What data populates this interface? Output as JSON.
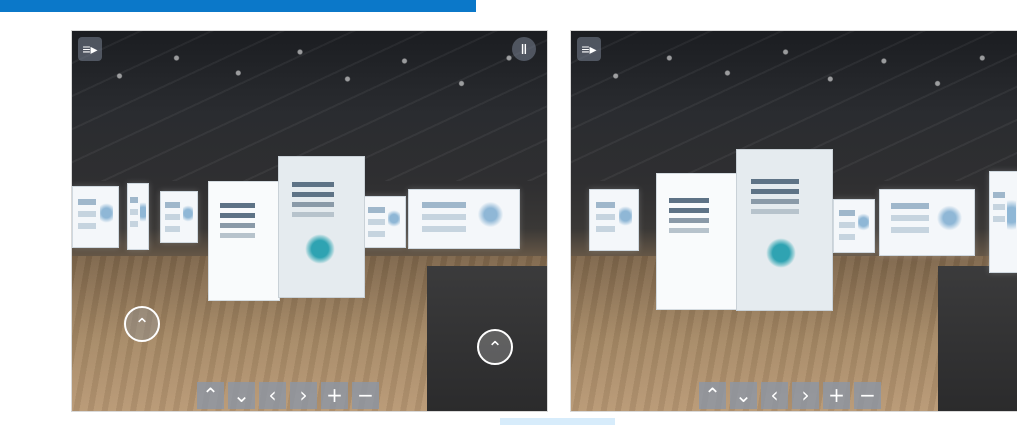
{
  "header_bar_color": "#0b78c9",
  "viewers": [
    {
      "menu_icon": "menu-expand-icon",
      "pause_icon": "pause-icon",
      "nav_icon": "chevron-up-circle-icon",
      "controls": [
        {
          "icon": "up-icon",
          "glyph": "⌃"
        },
        {
          "icon": "down-icon",
          "glyph": "⌄"
        },
        {
          "icon": "left-icon",
          "glyph": "‹"
        },
        {
          "icon": "right-icon",
          "glyph": "›"
        },
        {
          "icon": "zoom-in-icon",
          "glyph": "+"
        },
        {
          "icon": "zoom-out-icon",
          "glyph": "−"
        }
      ]
    },
    {
      "menu_icon": "menu-expand-icon",
      "controls": [
        {
          "icon": "up-icon",
          "glyph": "⌃"
        },
        {
          "icon": "down-icon",
          "glyph": "⌄"
        },
        {
          "icon": "left-icon",
          "glyph": "‹"
        },
        {
          "icon": "right-icon",
          "glyph": "›"
        },
        {
          "icon": "zoom-in-icon",
          "glyph": "+"
        },
        {
          "icon": "zoom-out-icon",
          "glyph": "−"
        }
      ]
    }
  ],
  "glyphs": {
    "menu": "≡▸",
    "pause": "Ⅱ",
    "nav_up": "⌃"
  }
}
